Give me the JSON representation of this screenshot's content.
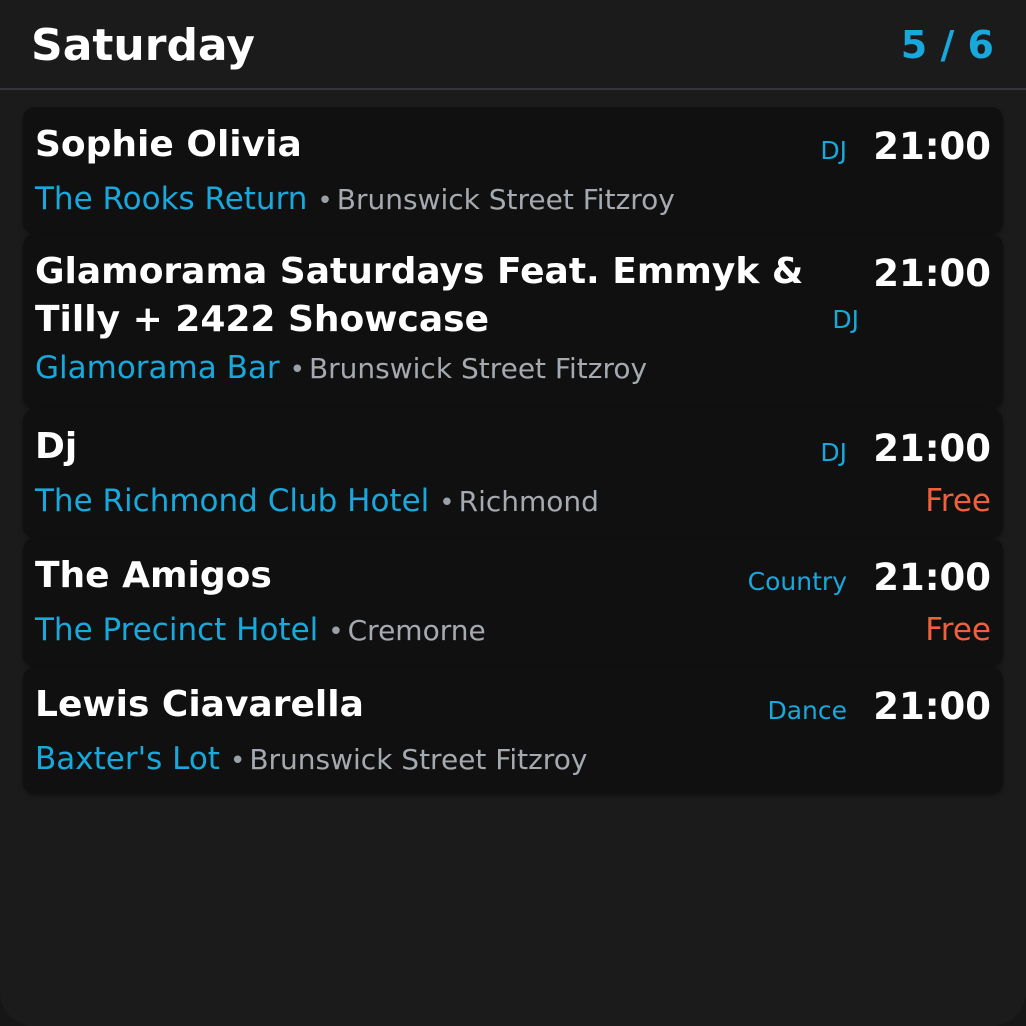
{
  "header": {
    "title": "Saturday",
    "pager": "5 / 6"
  },
  "events": [
    {
      "name": "Sophie Olivia",
      "genre": "DJ",
      "time": "21:00",
      "venue": "The Rooks Return",
      "separator": "•",
      "suburb": "Brunswick Street Fitzroy",
      "price": ""
    },
    {
      "name": "Glamorama Saturdays Feat. Emmyk & Tilly + 2422 Showcase",
      "genre": "DJ",
      "time": "21:00",
      "venue": "Glamorama Bar",
      "separator": "•",
      "suburb": "Brunswick Street Fitzroy",
      "price": ""
    },
    {
      "name": "Dj",
      "genre": "DJ",
      "time": "21:00",
      "venue": "The Richmond Club Hotel",
      "separator": "•",
      "suburb": "Richmond",
      "price": "Free"
    },
    {
      "name": "The Amigos",
      "genre": "Country",
      "time": "21:00",
      "venue": "The Precinct Hotel",
      "separator": "•",
      "suburb": "Cremorne",
      "price": "Free"
    },
    {
      "name": "Lewis Ciavarella",
      "genre": "Dance",
      "time": "21:00",
      "venue": "Baxter's Lot",
      "separator": "•",
      "suburb": "Brunswick Street Fitzroy",
      "price": ""
    }
  ],
  "colors": {
    "accent": "#18a8dc",
    "price": "#f0603c",
    "background": "#1b1b1b",
    "card": "#101010"
  }
}
